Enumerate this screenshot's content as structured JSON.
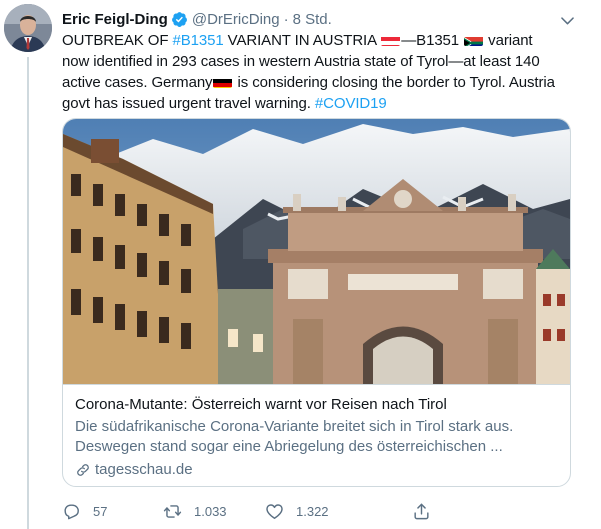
{
  "tweet": {
    "author_name": "Eric Feigl-Ding",
    "handle": "@DrEricDing",
    "separator": "·",
    "time": "8 Std.",
    "text": {
      "p1": "OUTBREAK OF ",
      "tag1": "#B1351",
      "p2": " VARIANT IN AUSTRIA ",
      "p3": "—B1351 ",
      "p4": " variant now identified in 293 cases in western Austria state of Tyrol—at least 140 active cases. Germany",
      "p5": " is considering closing the border to Tyrol. Austria govt has issued urgent travel warning. ",
      "tag2": "#COVID19"
    },
    "flags": [
      "austria-flag-icon",
      "south-africa-flag-icon",
      "germany-flag-icon"
    ]
  },
  "card": {
    "title": "Corona-Mutante: Österreich warnt vor Reisen nach Tirol",
    "description": "Die südafrikanische Corona-Variante breitet sich in Tirol stark aus. Deswegen stand sogar eine Abriegelung des österreichischen ...",
    "domain": "tagesschau.de"
  },
  "actions": {
    "reply_count": "57",
    "retweet_count": "1.033",
    "like_count": "1.322"
  },
  "colors": {
    "link": "#1da1f2",
    "secondary_text": "#5b7083",
    "border": "#cfd9de",
    "verified": "#1da1f2"
  }
}
